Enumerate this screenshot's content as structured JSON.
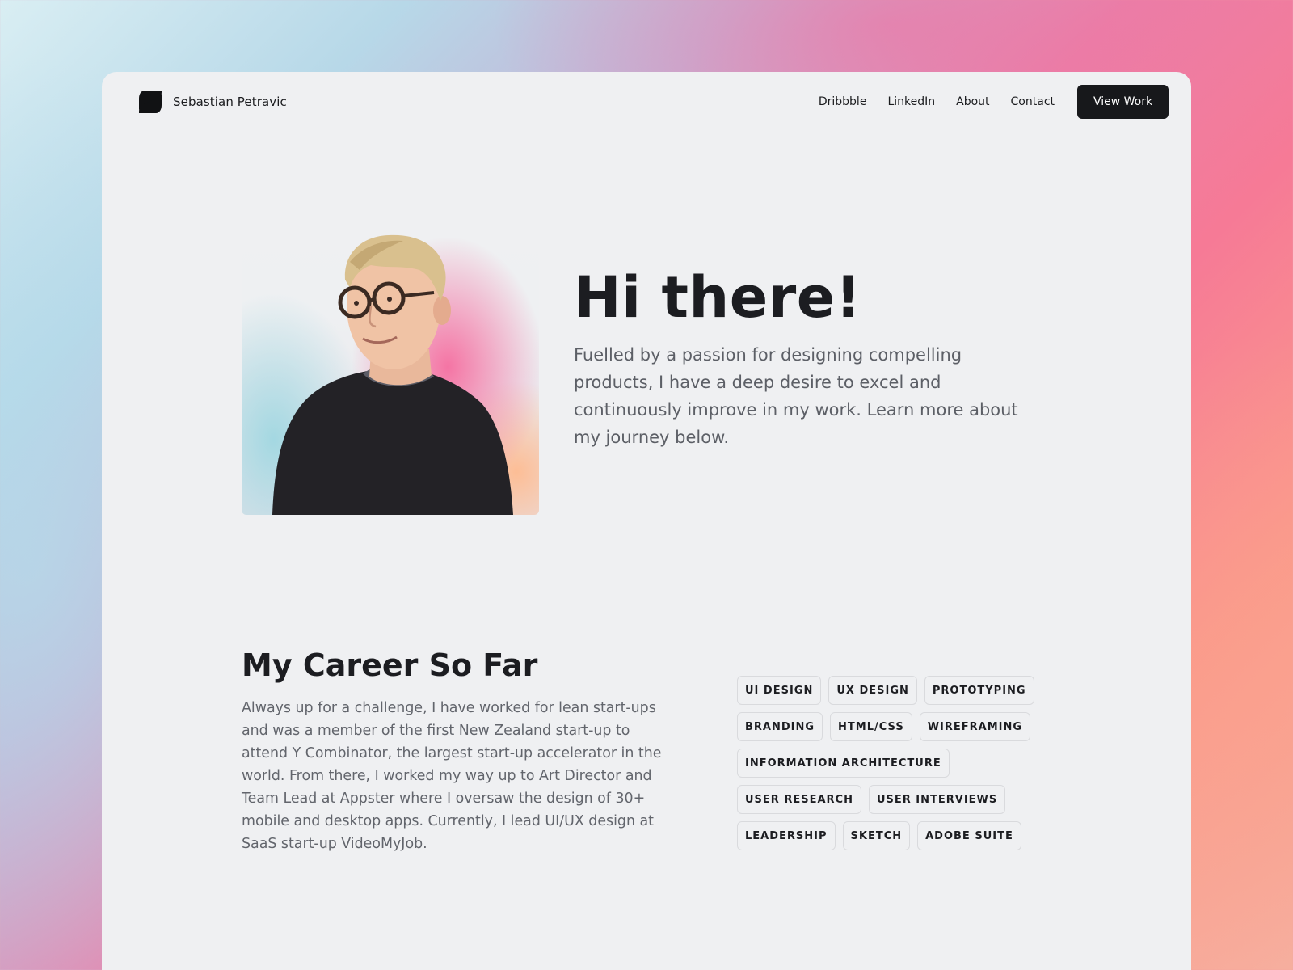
{
  "header": {
    "brand_name": "Sebastian Petravic",
    "logo_icon": "s-logo-icon",
    "nav_links": [
      "Dribbble",
      "LinkedIn",
      "About",
      "Contact"
    ],
    "cta_label": "View Work"
  },
  "hero": {
    "title": "Hi there!",
    "text": "Fuelled by a passion for designing compelling products, I have a deep desire to excel and continuously improve in my work. Learn more about my journey below."
  },
  "career": {
    "title": "My Career So Far",
    "text": "Always up for a challenge, I have worked for lean start-ups and was a member of the first New Zealand start-up to attend Y Combinator, the largest start-up accelerator in the world. From there, I worked my way up to Art Director and Team Lead at Appster where I oversaw the design of 30+ mobile and desktop apps. Currently, I lead UI/UX design at SaaS start-up VideoMyJob.",
    "skill_rows": [
      [
        "UI DESIGN",
        "UX DESIGN",
        "PROTOTYPING"
      ],
      [
        "BRANDING",
        "HTML/CSS",
        "WIREFRAMING"
      ],
      [
        "INFORMATION ARCHITECTURE"
      ],
      [
        "USER RESEARCH",
        "USER INTERVIEWS"
      ],
      [
        "LEADERSHIP",
        "SKETCH",
        "ADOBE SUITE"
      ]
    ]
  },
  "colors": {
    "background_pink": "#f67a96",
    "background_blue": "#b7d8e8",
    "page_surface": "#eff0f2",
    "button": "#17181b",
    "heading": "#1c1d21",
    "body_text": "#5c5f66"
  }
}
